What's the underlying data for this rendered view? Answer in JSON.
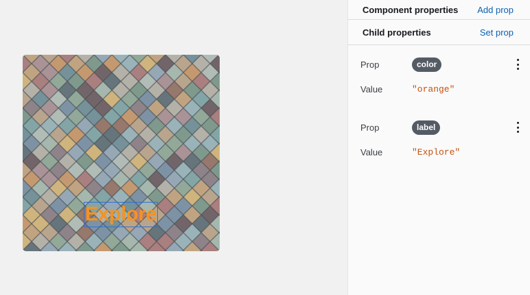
{
  "canvas": {
    "card_label": "Explore",
    "label_color": "#f5931f"
  },
  "panel": {
    "component_properties": {
      "title": "Component properties",
      "action": "Add prop"
    },
    "child_properties": {
      "title": "Child properties",
      "action": "Set prop"
    },
    "props": [
      {
        "key_label": "Prop",
        "name": "color",
        "value_label": "Value",
        "value": "\"orange\""
      },
      {
        "key_label": "Prop",
        "name": "label",
        "value_label": "Value",
        "value": "\"Explore\""
      }
    ],
    "menu_icon": "more-vertical-icon"
  }
}
